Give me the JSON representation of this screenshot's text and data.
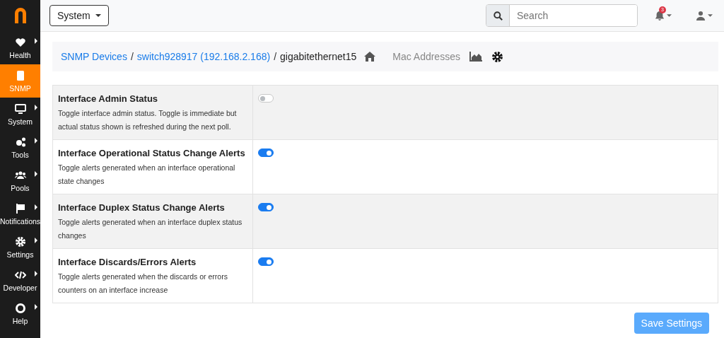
{
  "sidebar": {
    "items": [
      {
        "label": "Health",
        "selected": false,
        "expandable": true
      },
      {
        "label": "SNMP",
        "selected": true,
        "expandable": false
      },
      {
        "label": "System",
        "selected": false,
        "expandable": true
      },
      {
        "label": "Tools",
        "selected": false,
        "expandable": true
      },
      {
        "label": "Pools",
        "selected": false,
        "expandable": true
      },
      {
        "label": "Notifications",
        "selected": false,
        "expandable": true
      },
      {
        "label": "Settings",
        "selected": false,
        "expandable": true
      },
      {
        "label": "Developer",
        "selected": false,
        "expandable": true
      },
      {
        "label": "Help",
        "selected": false,
        "expandable": true
      }
    ]
  },
  "topbar": {
    "dropdown": "System",
    "search": {
      "placeholder": "Search"
    },
    "notification_count": "3"
  },
  "breadcrumb": {
    "separator": "/",
    "links": [
      "SNMP Devices",
      "switch928917 (192.168.2.168)"
    ],
    "current": "gigabitethernet15",
    "tab": "Mac Addresses"
  },
  "settings": [
    {
      "title": "Interface Admin Status",
      "description": "Toggle interface admin status. Toggle is immediate but actual status shown is refreshed during the next poll.",
      "on": false
    },
    {
      "title": "Interface Operational Status Change Alerts",
      "description": "Toggle alerts generated when an interface operational state changes",
      "on": true
    },
    {
      "title": "Interface Duplex Status Change Alerts",
      "description": "Toggle alerts generated when an interface duplex status changes",
      "on": true
    },
    {
      "title": "Interface Discards/Errors Alerts",
      "description": "Toggle alerts generated when the discards or errors counters on an interface increase",
      "on": true
    }
  ],
  "save_button": "Save Settings"
}
